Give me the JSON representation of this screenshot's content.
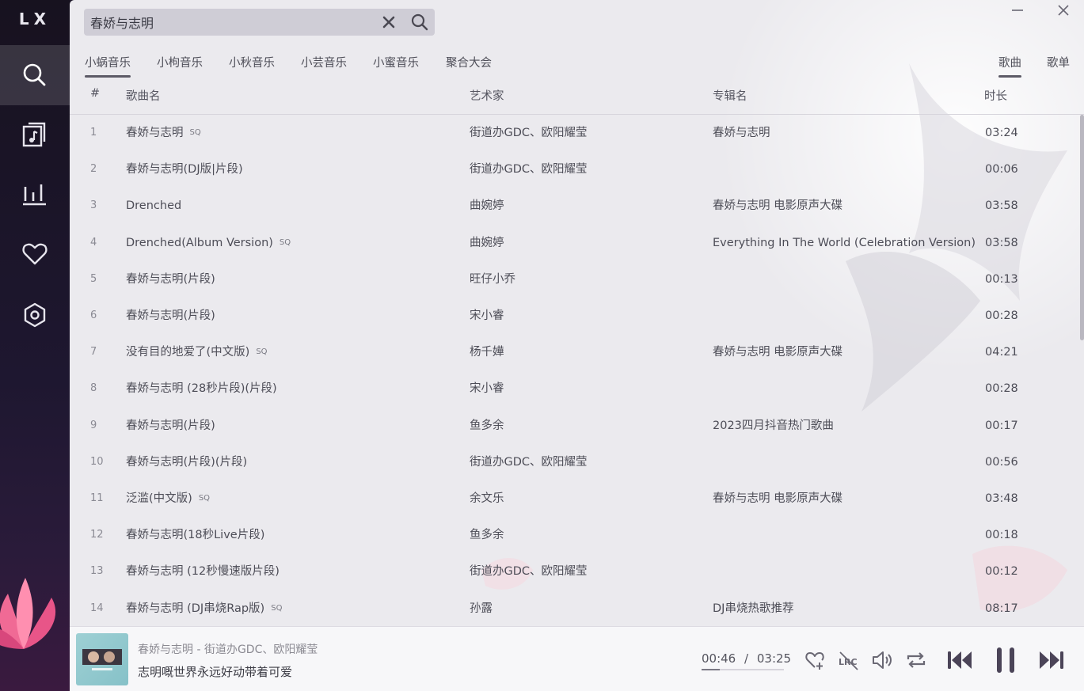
{
  "app": {
    "logo": "LX"
  },
  "sidebar": {
    "items": [
      {
        "name": "search",
        "active": true
      },
      {
        "name": "song-list",
        "active": false
      },
      {
        "name": "leaderboard",
        "active": false
      },
      {
        "name": "favorites",
        "active": false
      },
      {
        "name": "settings",
        "active": false
      }
    ]
  },
  "search": {
    "value": "春娇与志明",
    "placeholder": ""
  },
  "source_tabs": [
    "小蜗音乐",
    "小枸音乐",
    "小秋音乐",
    "小芸音乐",
    "小蜜音乐",
    "聚合大会"
  ],
  "active_source": "小蜗音乐",
  "type_tabs": [
    "歌曲",
    "歌单"
  ],
  "table": {
    "headers": {
      "num": "#",
      "title": "歌曲名",
      "artist": "艺术家",
      "album": "专辑名",
      "duration": "时长"
    },
    "rows": [
      {
        "num": "1",
        "title": "春娇与志明",
        "sq": "SQ",
        "artist": "街道办GDC、欧阳耀莹",
        "album": "春娇与志明",
        "duration": "03:24"
      },
      {
        "num": "2",
        "title": "春娇与志明(DJ版|片段)",
        "sq": "",
        "artist": "街道办GDC、欧阳耀莹",
        "album": "",
        "duration": "00:06"
      },
      {
        "num": "3",
        "title": "Drenched",
        "sq": "",
        "artist": "曲婉婷",
        "album": "春娇与志明 电影原声大碟",
        "duration": "03:58"
      },
      {
        "num": "4",
        "title": "Drenched(Album Version)",
        "sq": "SQ",
        "artist": "曲婉婷",
        "album": "Everything In The World (Celebration Version)",
        "duration": "03:58"
      },
      {
        "num": "5",
        "title": "春娇与志明(片段)",
        "sq": "",
        "artist": "旺仔小乔",
        "album": "",
        "duration": "00:13"
      },
      {
        "num": "6",
        "title": "春娇与志明(片段)",
        "sq": "",
        "artist": "宋小睿",
        "album": "",
        "duration": "00:28"
      },
      {
        "num": "7",
        "title": "没有目的地爱了(中文版)",
        "sq": "SQ",
        "artist": "杨千嬅",
        "album": "春娇与志明 电影原声大碟",
        "duration": "04:21"
      },
      {
        "num": "8",
        "title": "春娇与志明 (28秒片段)(片段)",
        "sq": "",
        "artist": "宋小睿",
        "album": "",
        "duration": "00:28"
      },
      {
        "num": "9",
        "title": "春娇与志明(片段)",
        "sq": "",
        "artist": "鱼多余",
        "album": "2023四月抖音热门歌曲",
        "duration": "00:17"
      },
      {
        "num": "10",
        "title": "春娇与志明(片段)(片段)",
        "sq": "",
        "artist": "街道办GDC、欧阳耀莹",
        "album": "",
        "duration": "00:56"
      },
      {
        "num": "11",
        "title": "泛滥(中文版)",
        "sq": "SQ",
        "artist": "余文乐",
        "album": "春娇与志明 电影原声大碟",
        "duration": "03:48"
      },
      {
        "num": "12",
        "title": "春娇与志明(18秒Live片段)",
        "sq": "",
        "artist": "鱼多余",
        "album": "",
        "duration": "00:18"
      },
      {
        "num": "13",
        "title": "春娇与志明 (12秒慢速版片段)",
        "sq": "",
        "artist": "街道办GDC、欧阳耀莹",
        "album": "",
        "duration": "00:12"
      },
      {
        "num": "14",
        "title": "春娇与志明 (DJ串烧Rap版)",
        "sq": "SQ",
        "artist": "孙露",
        "album": "DJ串烧热歌推荐",
        "duration": "08:17"
      }
    ]
  },
  "player": {
    "song_info": "春娇与志明 - 街道办GDC、欧阳耀莹",
    "lyric": "志明嘅世界永远好动带着可爱",
    "current_time": "00:46",
    "separator": "/",
    "total_time": "03:25",
    "progress": 0.224,
    "lrc_label": "LRC"
  },
  "colors": {
    "sidebar_bg": "#1b1527",
    "main_bg": "#ebeaee",
    "icon": "#4b4458",
    "accent_pink": "#e8678f"
  }
}
